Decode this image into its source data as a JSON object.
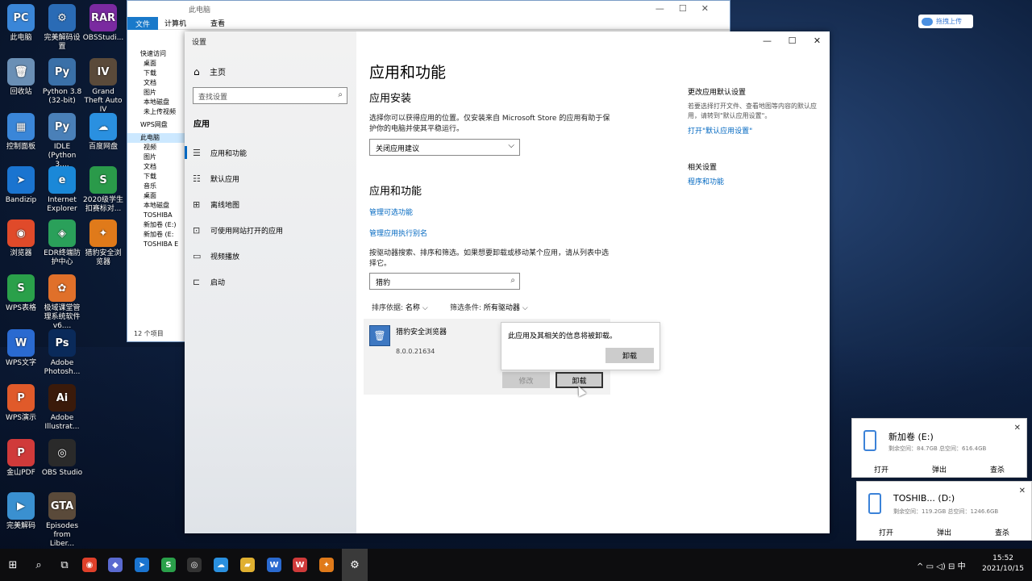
{
  "desktop": {
    "icons": [
      {
        "label": "此电脑",
        "color": "#3a86d8",
        "glyph": "PC"
      },
      {
        "label": "完美解码设置",
        "color": "#2a6bb5",
        "glyph": "⚙"
      },
      {
        "label": "OBSStudi...",
        "color": "#7a2aa0",
        "glyph": "RAR"
      },
      {
        "label": "回收站",
        "color": "#6a8fb5",
        "glyph": "🗑"
      },
      {
        "label": "Python 3.8 (32-bit)",
        "color": "#3a70a8",
        "glyph": "Py"
      },
      {
        "label": "Grand Theft Auto IV",
        "color": "#5a4a3a",
        "glyph": "IV"
      },
      {
        "label": "控制面板",
        "color": "#3a86d8",
        "glyph": "▦"
      },
      {
        "label": "IDLE (Python 3....",
        "color": "#4a80b8",
        "glyph": "Py"
      },
      {
        "label": "百度网盘",
        "color": "#2a90e0",
        "glyph": "☁"
      },
      {
        "label": "Bandizip",
        "color": "#1a74d0",
        "glyph": "➤"
      },
      {
        "label": "Internet Explorer",
        "color": "#1a88d8",
        "glyph": "e"
      },
      {
        "label": "2020级学生扣赛标对...",
        "color": "#2a9a4a",
        "glyph": "S"
      },
      {
        "label": "浏览器",
        "color": "#e04a2a",
        "glyph": "◉"
      },
      {
        "label": "EDR终端防护中心",
        "color": "#2aa05a",
        "glyph": "◈"
      },
      {
        "label": "猎豹安全浏览器",
        "color": "#e07a1a",
        "glyph": "✦"
      },
      {
        "label": "WPS表格",
        "color": "#2aa04a",
        "glyph": "S"
      },
      {
        "label": "极域课堂管理系统软件v6....",
        "color": "#e0702a",
        "glyph": "✿"
      },
      {
        "label": "WPS文字",
        "color": "#2a6ad0",
        "glyph": "W"
      },
      {
        "label": "Adobe Photosh...",
        "color": "#0a2a5a",
        "glyph": "Ps"
      },
      {
        "label": "WPS演示",
        "color": "#e05a2a",
        "glyph": "P"
      },
      {
        "label": "Adobe Illustrat...",
        "color": "#3a1a0a",
        "glyph": "Ai"
      },
      {
        "label": "金山PDF",
        "color": "#d03a3a",
        "glyph": "P"
      },
      {
        "label": "OBS Studio",
        "color": "#2a2a2a",
        "glyph": "◎"
      },
      {
        "label": "完美解码",
        "color": "#3a90d0",
        "glyph": "▶"
      },
      {
        "label": "Episodes from Liber...",
        "color": "#5a4a3a",
        "glyph": "GTA"
      }
    ]
  },
  "explorer": {
    "title": "此电脑",
    "ribbon": {
      "file": "文件",
      "computer": "计算机",
      "view": "查看"
    },
    "nav": [
      "快速访问",
      "桌面",
      "下载",
      "文档",
      "图片",
      "本地磁盘",
      "未上传视频",
      "WPS网盘",
      "此电脑",
      "视频",
      "图片",
      "文档",
      "下载",
      "音乐",
      "桌面",
      "本地磁盘",
      "TOSHIBA",
      "新加卷 (E:)",
      "新加卷 (E:",
      "TOSHIBA E"
    ],
    "status": "12 个项目"
  },
  "settings": {
    "window_title": "设置",
    "caption": {
      "minimize": "—",
      "maximize": "☐",
      "close": "✕"
    },
    "sidebar": {
      "home": "主页",
      "search_placeholder": "查找设置",
      "section": "应用",
      "items": [
        {
          "label": "应用和功能",
          "glyph": "☰"
        },
        {
          "label": "默认应用",
          "glyph": "☷"
        },
        {
          "label": "离线地图",
          "glyph": "⊞"
        },
        {
          "label": "可使用网站打开的应用",
          "glyph": "⊡"
        },
        {
          "label": "视频播放",
          "glyph": "▭"
        },
        {
          "label": "启动",
          "glyph": "⊏"
        }
      ]
    },
    "main": {
      "title": "应用和功能",
      "install_heading": "应用安装",
      "install_desc": "选择你可以获得应用的位置。仅安装来自 Microsoft Store 的应用有助于保护你的电脑并使其平稳运行。",
      "install_dropdown": "关闭应用建议",
      "apps_heading": "应用和功能",
      "link_optional": "管理可选功能",
      "link_alias": "管理应用执行别名",
      "search_desc": "按驱动器搜索、排序和筛选。如果想要卸载或移动某个应用，请从列表中选择它。",
      "search_value": "猎豹",
      "sort_label": "排序依据:",
      "sort_value": "名称",
      "filter_label": "筛选条件:",
      "filter_value": "所有驱动器",
      "app": {
        "name": "猎豹安全浏览器",
        "version": "8.0.0.21634",
        "modify": "修改",
        "uninstall": "卸载"
      },
      "flyout": {
        "message": "此应用及其相关的信息将被卸载。",
        "confirm": "卸载"
      }
    },
    "right": {
      "default_title": "更改应用默认设置",
      "default_desc": "若要选择打开文件、查看地图等内容的默认应用，请转到\"默认应用设置\"。",
      "default_link": "打开\"默认应用设置\"",
      "related_title": "相关设置",
      "related_link": "程序和功能"
    }
  },
  "upload_pill": "拖拽上传",
  "toasts": [
    {
      "title": "新加卷 (E:)",
      "sub": "剩余空间：84.7GB    总空间：616.4GB",
      "actions": [
        "打开",
        "弹出",
        "查杀"
      ]
    },
    {
      "title": "TOSHIB...   (D:)",
      "sub": "剩余空间：119.2GB    总空间：1246.6GB",
      "actions": [
        "打开",
        "弹出",
        "查杀"
      ]
    }
  ],
  "taskbar": {
    "time": "15:52",
    "date": "2021/10/15",
    "ime": "中",
    "apps": [
      {
        "name": "start",
        "glyph": "⊞",
        "color": ""
      },
      {
        "name": "search",
        "glyph": "⌕",
        "color": ""
      },
      {
        "name": "task-view",
        "glyph": "⧉",
        "color": ""
      },
      {
        "name": "chrome",
        "glyph": "◉",
        "color": "#e0402a"
      },
      {
        "name": "app-1",
        "glyph": "◆",
        "color": "#5a6ad0"
      },
      {
        "name": "bandizip",
        "glyph": "➤",
        "color": "#1a74d0"
      },
      {
        "name": "wps-sheet",
        "glyph": "S",
        "color": "#2aa04a"
      },
      {
        "name": "obs",
        "glyph": "◎",
        "color": "#333333"
      },
      {
        "name": "baidu",
        "glyph": "☁",
        "color": "#2a90e0"
      },
      {
        "name": "explorer",
        "glyph": "▰",
        "color": "#e0b030"
      },
      {
        "name": "wps-writer",
        "glyph": "W",
        "color": "#2a6ad0"
      },
      {
        "name": "wps",
        "glyph": "W",
        "color": "#d03a3a"
      },
      {
        "name": "cheetah",
        "glyph": "✦",
        "color": "#e07a1a"
      },
      {
        "name": "settings",
        "glyph": "⚙",
        "color": ""
      }
    ]
  }
}
